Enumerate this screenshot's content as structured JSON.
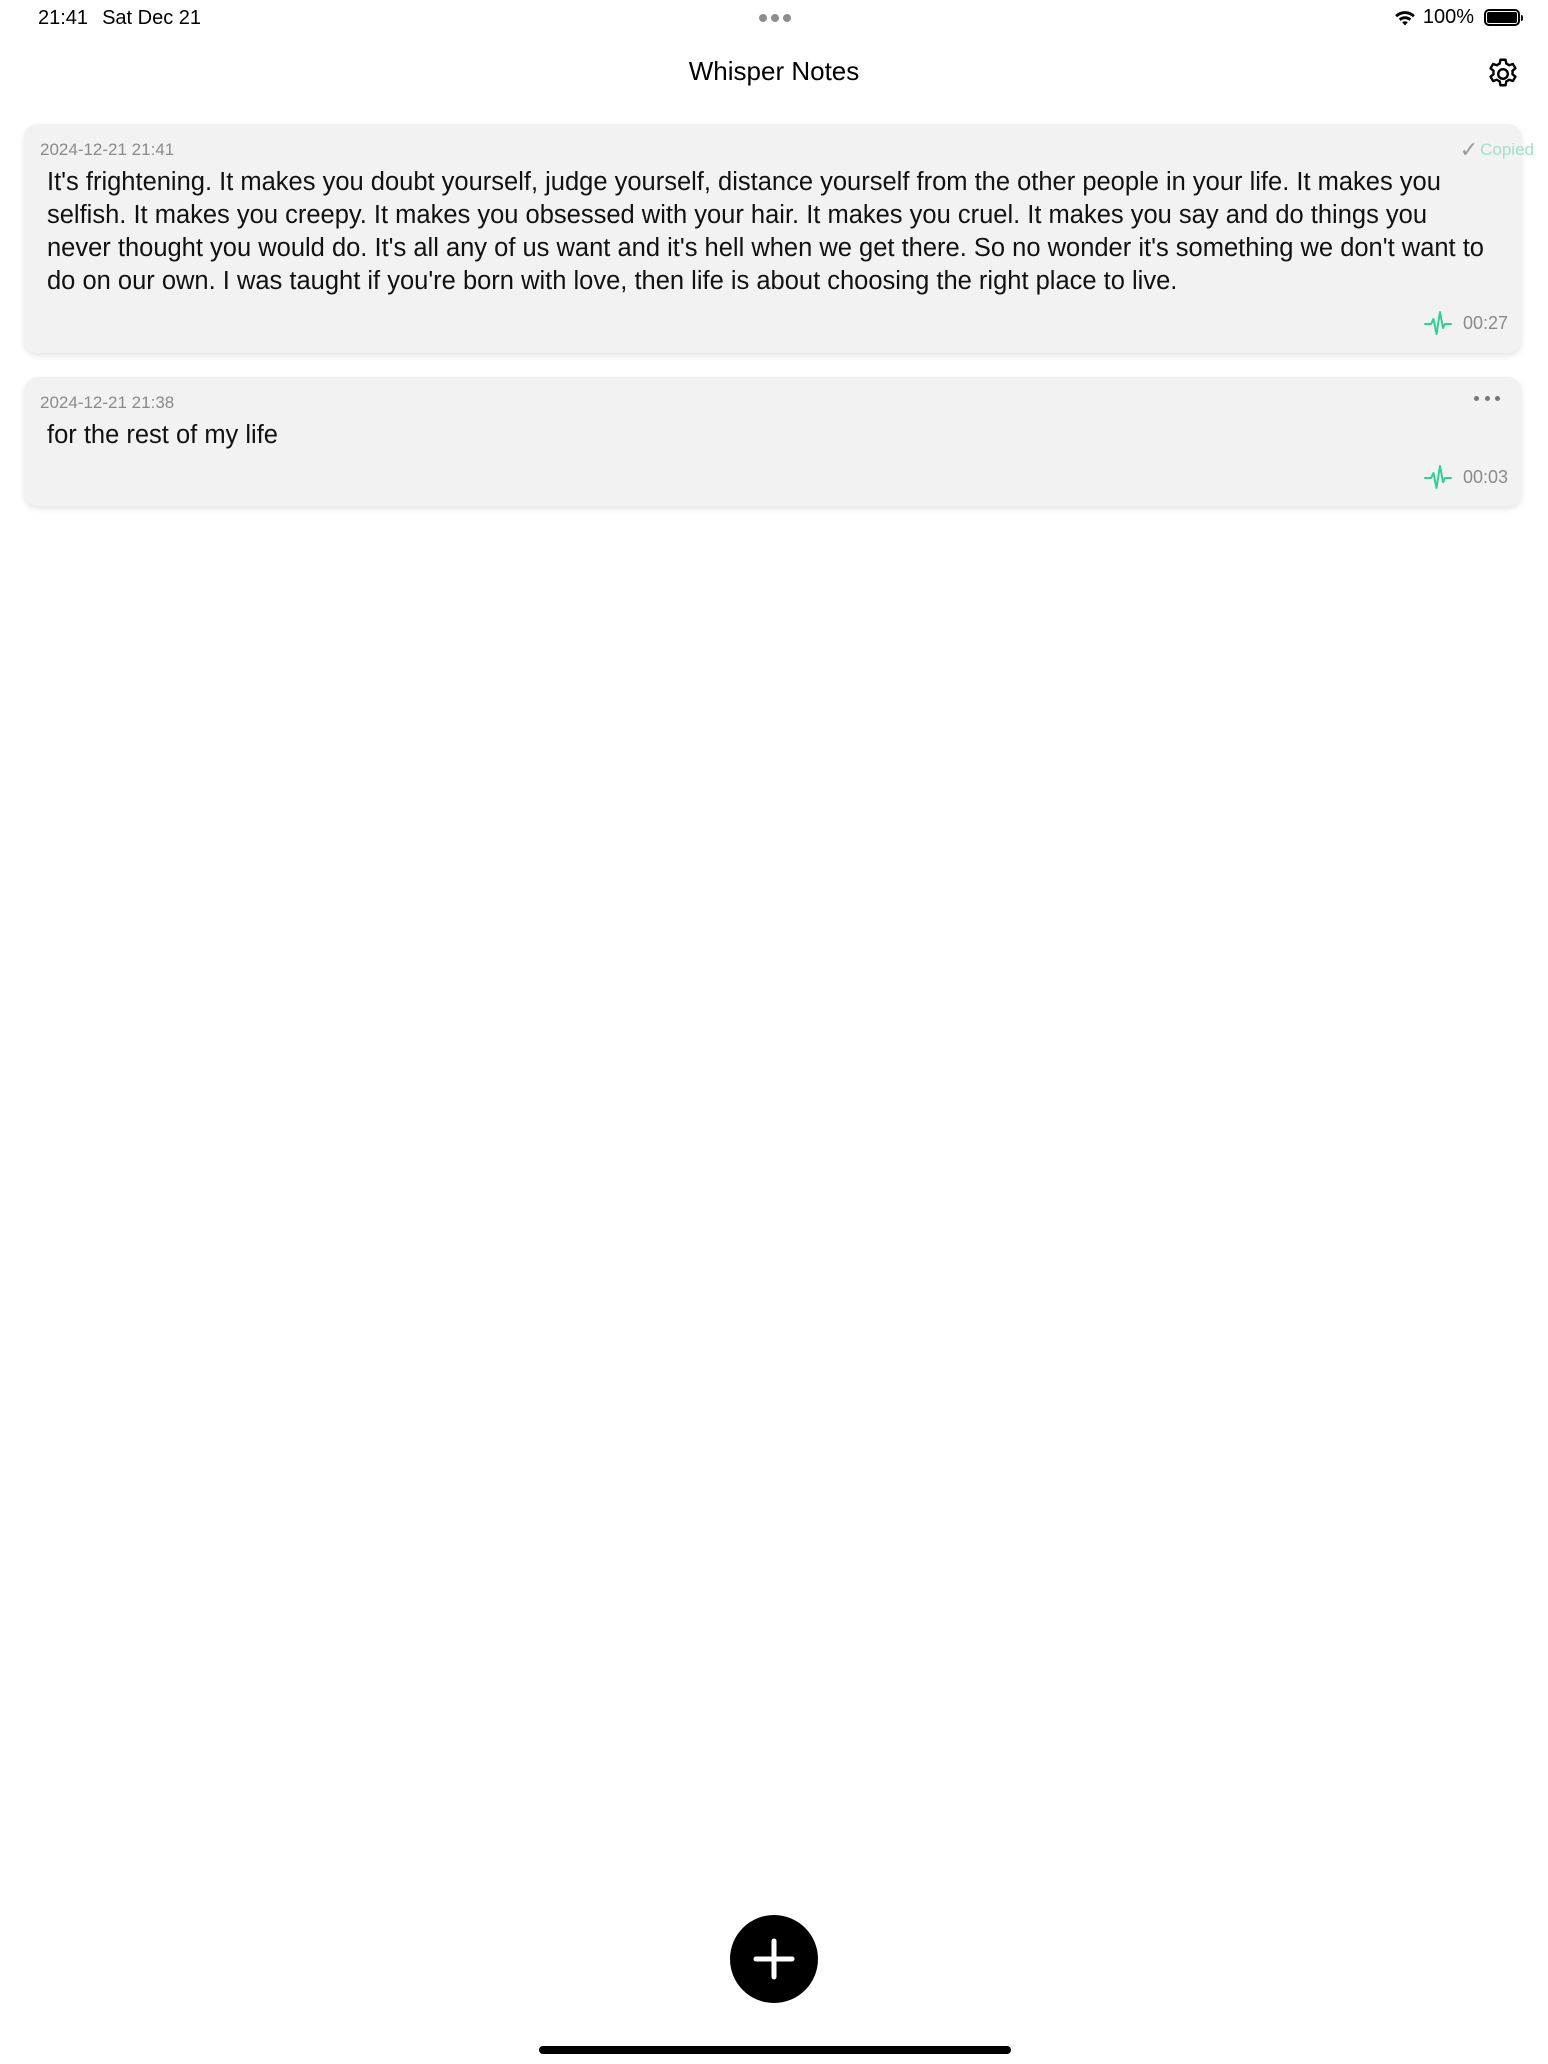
{
  "status_bar": {
    "time": "21:41",
    "date": "Sat Dec 21",
    "battery": "100%"
  },
  "app": {
    "title": "Whisper Notes"
  },
  "notes": [
    {
      "date": "2024-12-21 21:41",
      "text": "It's frightening. It makes you doubt yourself, judge yourself, distance yourself from the other people in your life. It makes you selfish. It makes you creepy. It makes you obsessed with your hair. It makes you cruel. It makes you say and do things you never thought you would do. It's all any of us want and it's hell when we get there. So no wonder it's something we don't want to do on our own. I was taught if you're born with love, then life is about choosing the right place to live.",
      "duration": "00:27",
      "copied_label": "Copied"
    },
    {
      "date": "2024-12-21 21:38",
      "text": "for the rest of my life",
      "duration": "00:03"
    }
  ],
  "colors": {
    "accent": "#2fcf9a",
    "card_bg": "#f2f2f2",
    "meta_text": "#8a8a8a"
  },
  "icons": {
    "settings": "gear-icon",
    "waveform": "waveform-icon",
    "more": "more-icon",
    "add": "plus-icon"
  }
}
